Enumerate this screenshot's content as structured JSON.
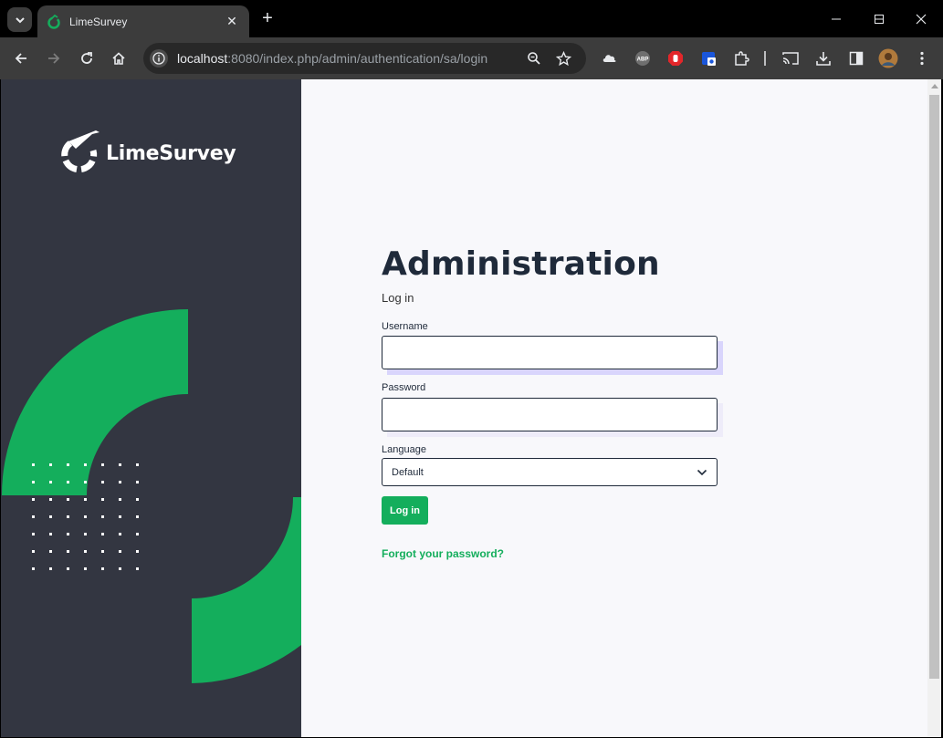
{
  "browser": {
    "tab_title": "LimeSurvey",
    "url_host": "localhost",
    "url_path": ":8080/index.php/admin/authentication/sa/login",
    "accent_color": "#14ae5c"
  },
  "sidebar": {
    "brand": "LimeSurvey"
  },
  "login": {
    "title": "Administration",
    "subtitle": "Log in",
    "username_label": "Username",
    "username_value": "",
    "password_label": "Password",
    "password_value": "",
    "language_label": "Language",
    "language_selected": "Default",
    "submit_label": "Log in",
    "forgot_link": "Forgot your password?"
  },
  "icons": {
    "tab_search": "chevron-down-icon",
    "favicon": "limesurvey-favicon",
    "new_tab": "plus-icon",
    "back": "arrow-left-icon",
    "forward": "arrow-right-icon",
    "reload": "reload-icon",
    "home": "home-icon",
    "site_info": "info-icon",
    "zoom": "zoom-icon",
    "bookmark": "star-icon",
    "extensions": [
      "cloud-extension-icon",
      "adblock-icon",
      "stop-hand-icon",
      "shield-extension-icon",
      "puzzle-icon",
      "cast-icon",
      "download-icon",
      "side-panel-icon",
      "profile-avatar",
      "menu-icon"
    ]
  }
}
